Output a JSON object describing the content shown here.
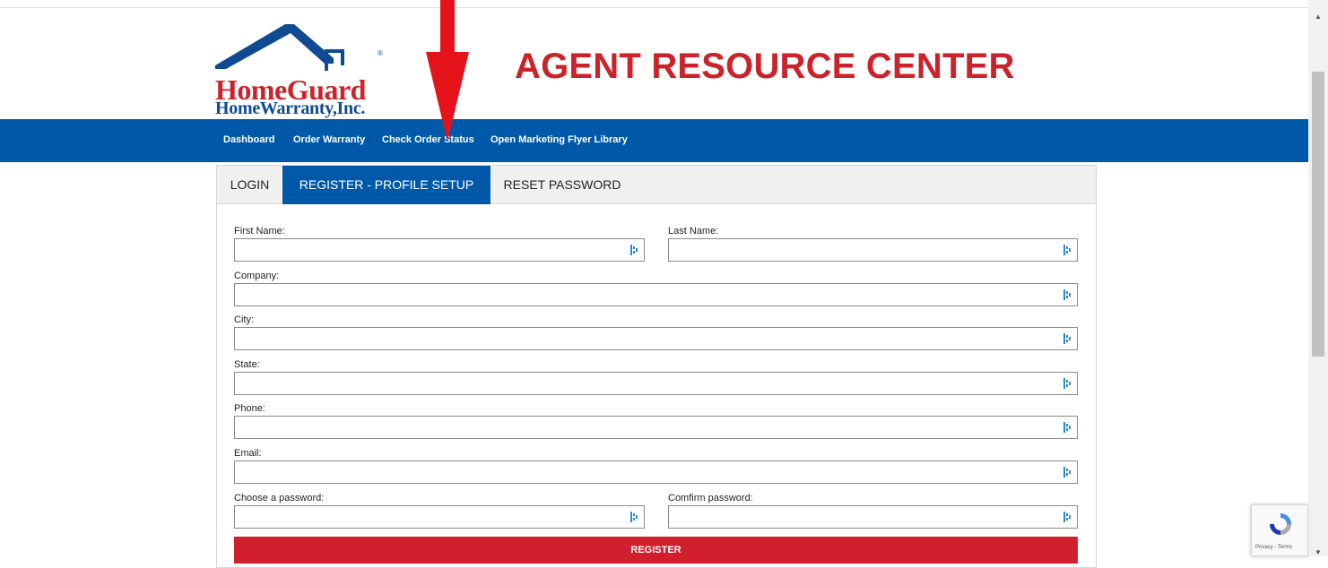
{
  "header": {
    "logo_name": "HomeGuard",
    "logo_sub": "HomeWarranty,Inc.",
    "logo_reg": "®",
    "title": "AGENT RESOURCE CENTER"
  },
  "nav": {
    "items": [
      {
        "label": "Dashboard"
      },
      {
        "label": "Order Warranty"
      },
      {
        "label": "Check Order Status"
      },
      {
        "label": "Open Marketing Flyer Library"
      }
    ]
  },
  "tabs": [
    {
      "label": "LOGIN",
      "active": false
    },
    {
      "label": "REGISTER - PROFILE SETUP",
      "active": true
    },
    {
      "label": "RESET PASSWORD",
      "active": false
    }
  ],
  "form": {
    "first_name_label": "First Name:",
    "last_name_label": "Last Name:",
    "company_label": "Company:",
    "city_label": "City:",
    "state_label": "State:",
    "phone_label": "Phone:",
    "email_label": "Email:",
    "password_label": "Choose a password:",
    "confirm_label": "Comfirm password:",
    "first_name_value": "",
    "last_name_value": "",
    "company_value": "",
    "city_value": "",
    "state_value": "",
    "phone_value": "",
    "email_value": "",
    "password_value": "",
    "confirm_value": "",
    "register_label": "REGISTER"
  },
  "recaptcha": {
    "text": "Privacy - Terms"
  },
  "colors": {
    "brand_red": "#cc2229",
    "brand_blue": "#0059a8",
    "button_red": "#d0202e"
  }
}
